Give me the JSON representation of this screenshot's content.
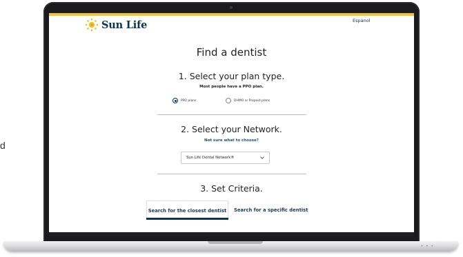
{
  "side_text": "d",
  "colors": {
    "brand_yellow": "#f2c330",
    "brand_navy": "#0a3552",
    "link_blue": "#1a5276"
  },
  "header": {
    "logo_text": "Sun Life",
    "logo_icon": "sun-icon",
    "language_link": "Espanol"
  },
  "page": {
    "title": "Find a dentist"
  },
  "step1": {
    "title": "1. Select your plan type.",
    "subtitle": "Most people have a PPO plan.",
    "options": [
      {
        "label": "PPO plans",
        "selected": true
      },
      {
        "label": "DHMO or Prepaid plans",
        "selected": false
      }
    ]
  },
  "step2": {
    "title": "2. Select your Network.",
    "help_link": "Not sure what to choose?",
    "select_value": "Sun Life Dental Network®",
    "select_icon": "chevron-down-icon"
  },
  "step3": {
    "title": "3. Set Criteria.",
    "tabs": [
      {
        "label": "Search for the closest dentist",
        "active": true
      },
      {
        "label": "Search for a specific dentist",
        "active": false
      }
    ]
  }
}
